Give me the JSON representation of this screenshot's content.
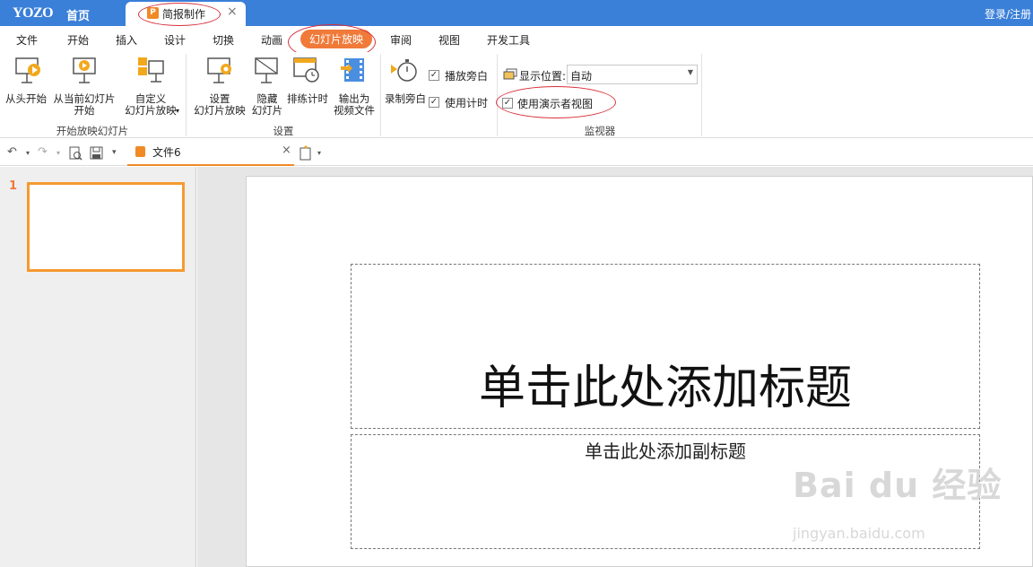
{
  "app": {
    "logo": "YOZO",
    "home": "首页",
    "doc_tab": "简报制作",
    "doc_tab_icon": "P",
    "close_glyph": "×",
    "login": "登录/注册"
  },
  "menu": [
    "文件",
    "开始",
    "插入",
    "设计",
    "切换",
    "动画",
    "幻灯片放映",
    "审阅",
    "视图",
    "开发工具"
  ],
  "ribbon": {
    "start_show": {
      "from_start": "从头开始",
      "from_current_1": "从当前幻灯片",
      "from_current_2": "开始",
      "custom_1": "自定义",
      "custom_2": "幻灯片放映",
      "group": "开始放映幻灯片"
    },
    "settings": {
      "setup_1": "设置",
      "setup_2": "幻灯片放映",
      "hide_1": "隐藏",
      "hide_2": "幻灯片",
      "rehearse": "排练计时",
      "export_1": "输出为",
      "export_2": "视频文件",
      "group": "设置"
    },
    "narration": {
      "record": "录制旁白",
      "play_narration": "播放旁白",
      "use_timing": "使用计时"
    },
    "monitor": {
      "display_label": "显示位置:",
      "display_value": "自动",
      "presenter_view": "使用演示者视图",
      "group": "监视器"
    }
  },
  "quick_access": {
    "file_tab": "文件6"
  },
  "thumbnails": [
    {
      "number": "1"
    }
  ],
  "slide": {
    "title_placeholder": "单击此处添加标题",
    "subtitle_placeholder": "单击此处添加副标题"
  },
  "watermark": {
    "brand": "Bai du 经验",
    "url": "jingyan.baidu.com"
  },
  "colors": {
    "titlebar": "#3a7fd8",
    "accent": "#f07a3a",
    "annotation": "#d9303a"
  }
}
